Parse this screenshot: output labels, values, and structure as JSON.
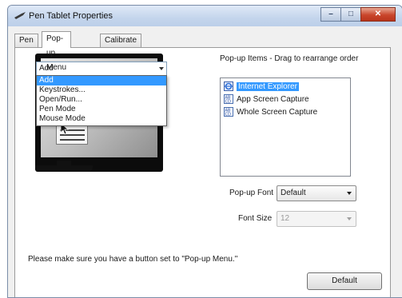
{
  "window": {
    "title": "Pen Tablet Properties",
    "min_glyph": "–",
    "max_glyph": "□",
    "close_glyph": "✕"
  },
  "tabs": [
    {
      "label": "Pen"
    },
    {
      "label": "Pop-up Menu",
      "active": true
    },
    {
      "label": "Calibrate"
    }
  ],
  "action_combo": {
    "value": "Add",
    "options": [
      "Add",
      "Keystrokes...",
      "Open/Run...",
      "Pen Mode",
      "Mouse Mode"
    ],
    "selected_index": 0
  },
  "popup_items": {
    "label": "Pop-up Items - Drag to rearrange order",
    "items": [
      {
        "label": "Internet Explorer",
        "icon": "internet-explorer-icon",
        "selected": true
      },
      {
        "label": "App Screen Capture",
        "icon": "screen-capture-icon"
      },
      {
        "label": "Whole Screen Capture",
        "icon": "screen-capture-icon"
      }
    ]
  },
  "popup_font": {
    "label": "Pop-up Font",
    "value": "Default"
  },
  "font_size": {
    "label": "Font Size",
    "value": "12",
    "disabled": true
  },
  "note": "Please make sure you have a button set to \"Pop-up Menu.\"",
  "default_button": "Default",
  "colors": {
    "selection": "#3399ff",
    "title_bar": "#c4d5ec",
    "close_button": "#c9462c"
  }
}
